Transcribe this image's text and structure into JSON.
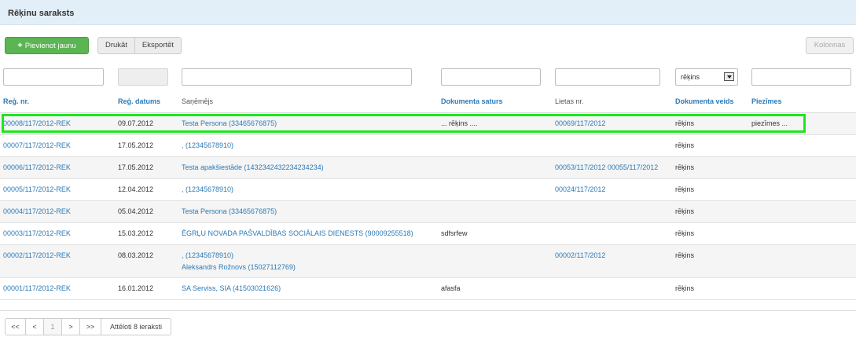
{
  "panel": {
    "title": "Rēķinu saraksts"
  },
  "toolbar": {
    "add_label": "Pievienot jaunu",
    "print_label": "Drukāt",
    "export_label": "Eksportēt",
    "columns_label": "Kolonnas"
  },
  "filters": {
    "reg_nr": "",
    "reg_date": "",
    "recipient": "",
    "doc_content": "",
    "case_nr": "",
    "doc_type_selected": "rēķins",
    "notes": ""
  },
  "columns": {
    "reg_nr": "Reģ. nr.",
    "reg_date": "Reģ. datums",
    "recipient": "Saņēmējs",
    "doc_content": "Dokumenta saturs",
    "case_nr": "Lietas nr.",
    "doc_type": "Dokumenta veids",
    "notes": "Piezīmes"
  },
  "rows": [
    {
      "reg_nr": "00008/117/2012-REK",
      "date": "09.07.2012",
      "recipient": "Testa Persona (33465676875)",
      "recipient2": "",
      "content": "... rēķins ....",
      "case": "00069/117/2012",
      "type": "rēķins",
      "notes": "piezīmes ..."
    },
    {
      "reg_nr": "00007/117/2012-REK",
      "date": "17.05.2012",
      "recipient": ", (12345678910)",
      "recipient2": "",
      "content": "",
      "case": "",
      "type": "rēķins",
      "notes": ""
    },
    {
      "reg_nr": "00006/117/2012-REK",
      "date": "17.05.2012",
      "recipient": "Testa apakšiestāde (1432342432234234234)",
      "recipient2": "",
      "content": "",
      "case": "00053/117/2012 00055/117/2012",
      "type": "rēķins",
      "notes": ""
    },
    {
      "reg_nr": "00005/117/2012-REK",
      "date": "12.04.2012",
      "recipient": ", (12345678910)",
      "recipient2": "",
      "content": "",
      "case": "00024/117/2012",
      "type": "rēķins",
      "notes": ""
    },
    {
      "reg_nr": "00004/117/2012-REK",
      "date": "05.04.2012",
      "recipient": "Testa Persona (33465676875)",
      "recipient2": "",
      "content": "",
      "case": "",
      "type": "rēķins",
      "notes": ""
    },
    {
      "reg_nr": "00003/117/2012-REK",
      "date": "15.03.2012",
      "recipient": "ĒGRĻU NOVADA PAŠVALDĪBAS SOCIĀLAIS DIENESTS (90009255518)",
      "recipient2": "",
      "content": "sdfsrfew",
      "case": "",
      "type": "rēķins",
      "notes": ""
    },
    {
      "reg_nr": "00002/117/2012-REK",
      "date": "08.03.2012",
      "recipient": ", (12345678910)",
      "recipient2": "Aleksandrs Rožnovs (15027112769)",
      "content": "",
      "case": "00002/117/2012",
      "type": "rēķins",
      "notes": ""
    },
    {
      "reg_nr": "00001/117/2012-REK",
      "date": "16.01.2012",
      "recipient": "SA Serviss, SIA (41503021626)",
      "recipient2": "",
      "content": "afasfa",
      "case": "",
      "type": "rēķins",
      "notes": ""
    }
  ],
  "pager": {
    "first": "<<",
    "prev": "<",
    "page": "1",
    "next": ">",
    "last": ">>",
    "summary": "Attēloti 8 ieraksti"
  }
}
